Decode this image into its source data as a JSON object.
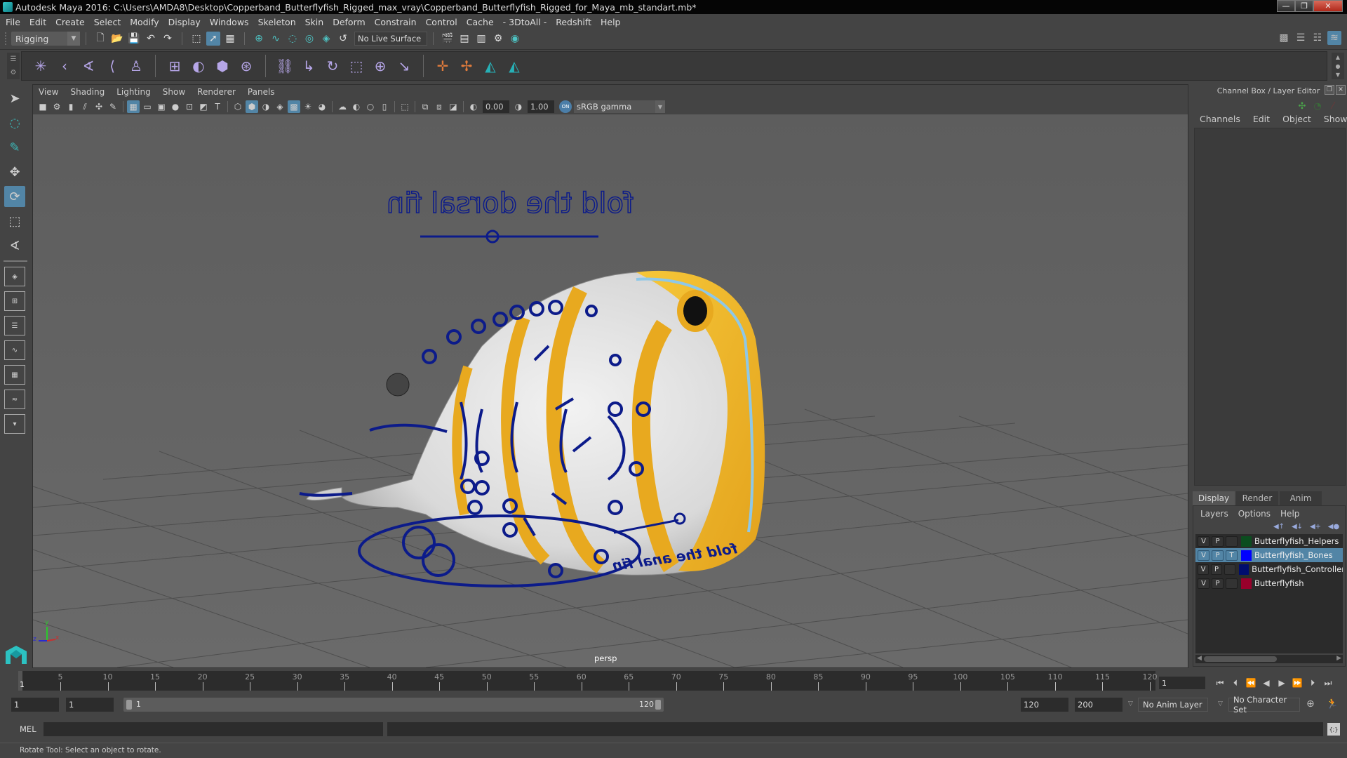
{
  "window": {
    "title": "Autodesk Maya 2016: C:\\Users\\AMDA8\\Desktop\\Copperband_Butterflyfish_Rigged_max_vray\\Copperband_Butterflyfish_Rigged_for_Maya_mb_standart.mb*",
    "minimize": "—",
    "maximize": "❐",
    "close": "✕"
  },
  "menubar": [
    "File",
    "Edit",
    "Create",
    "Select",
    "Modify",
    "Display",
    "Windows",
    "Skeleton",
    "Skin",
    "Deform",
    "Constrain",
    "Control",
    "Cache",
    "- 3DtoAll -",
    "Redshift",
    "Help"
  ],
  "statusline": {
    "mode": "Rigging",
    "live_surface": "No Live Surface"
  },
  "viewport": {
    "menu": [
      "View",
      "Shading",
      "Lighting",
      "Show",
      "Renderer",
      "Panels"
    ],
    "exposure": "0.00",
    "gamma": "1.00",
    "color_space_toggle": "ON",
    "color_space": "sRGB gamma",
    "camera_label": "persp",
    "annotations": {
      "dorsal": "fold the dorsal fin",
      "anal": "fold the anal fin"
    },
    "axis": {
      "x": "x",
      "y": "y",
      "z": "z"
    }
  },
  "channel_box": {
    "title": "Channel Box / Layer Editor",
    "menu": [
      "Channels",
      "Edit",
      "Object",
      "Show"
    ]
  },
  "layer_editor": {
    "tabs": [
      "Display",
      "Render",
      "Anim"
    ],
    "active_tab": "Display",
    "menu": [
      "Layers",
      "Options",
      "Help"
    ],
    "layers": [
      {
        "v": "V",
        "p": "P",
        "t": "",
        "color": "#0b4d1f",
        "name": "Butterflyfish_Helpers",
        "selected": false
      },
      {
        "v": "V",
        "p": "P",
        "t": "T",
        "color": "#0000ff",
        "name": "Butterflyfish_Bones",
        "selected": true
      },
      {
        "v": "V",
        "p": "P",
        "t": "",
        "color": "#000d6e",
        "name": "Butterflyfish_Controllers",
        "selected": false
      },
      {
        "v": "V",
        "p": "P",
        "t": "",
        "color": "#99002b",
        "name": "Butterflyfish",
        "selected": false
      }
    ]
  },
  "timeline": {
    "start": 1,
    "end": 120,
    "tick_labels": [
      5,
      10,
      15,
      20,
      25,
      30,
      35,
      40,
      45,
      50,
      55,
      60,
      65,
      70,
      75,
      80,
      85,
      90,
      95,
      100,
      105,
      110,
      115,
      120
    ],
    "current_frame": "1",
    "current_marker": "1"
  },
  "range": {
    "start_field": "1",
    "playback_start": "1",
    "slider_start": "1",
    "slider_end": "120",
    "playback_end": "120",
    "end_field": "200",
    "anim_layer": "No Anim Layer",
    "character_set": "No Character Set"
  },
  "command_line": {
    "label": "MEL",
    "input": "",
    "result": ""
  },
  "help_line": "Rotate Tool: Select an object to rotate."
}
